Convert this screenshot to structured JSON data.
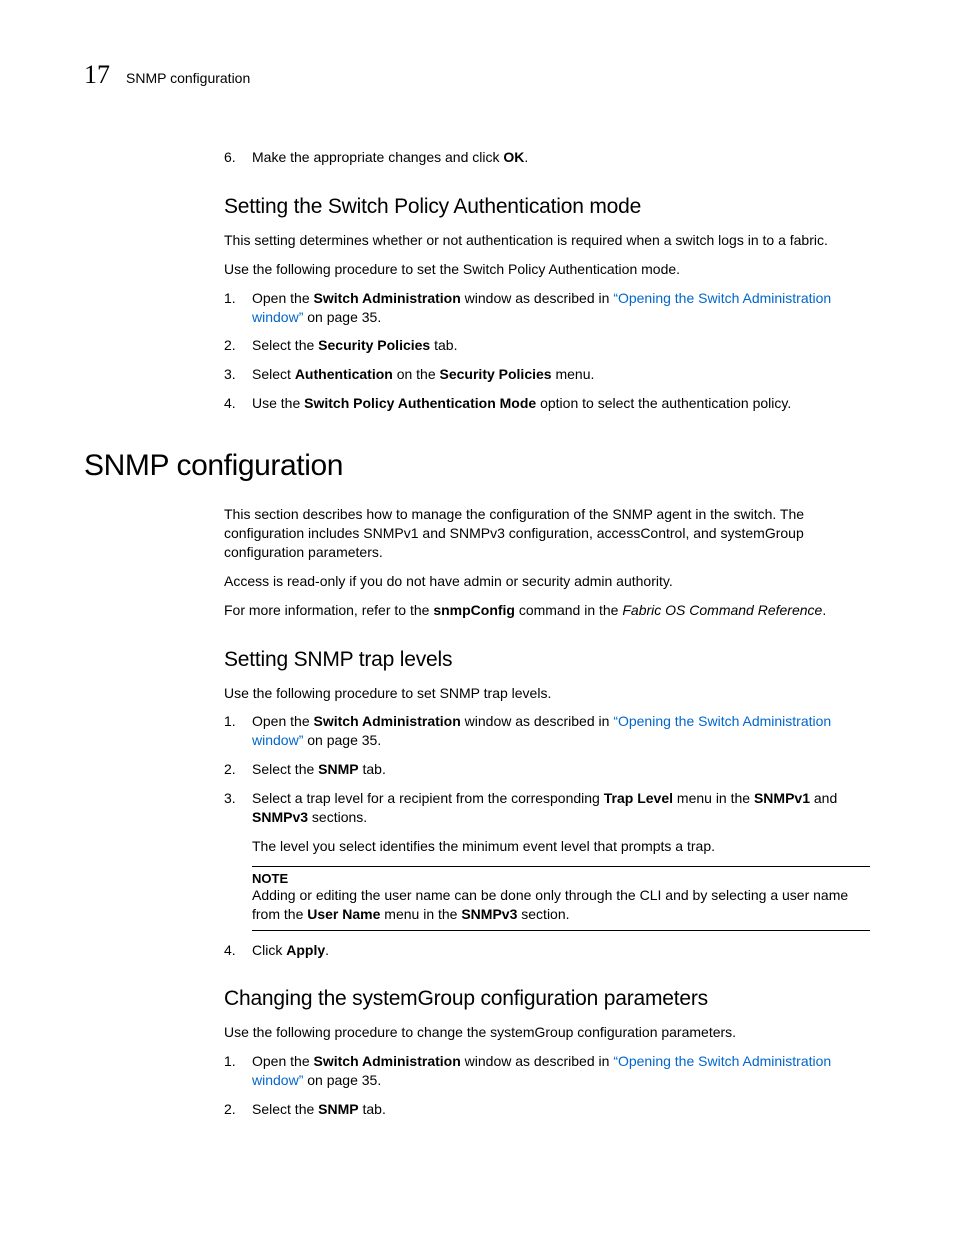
{
  "header": {
    "chapter_number": "17",
    "chapter_label": "SNMP configuration"
  },
  "step6": {
    "text1": "Make the appropriate changes and click ",
    "ok": "OK",
    "text2": "."
  },
  "sec1": {
    "title": "Setting the Switch Policy Authentication mode",
    "p1": "This setting determines whether or not authentication is required when a switch logs in to a fabric.",
    "p2": "Use the following procedure to set the Switch Policy Authentication mode.",
    "li1": {
      "a": "Open the ",
      "b": "Switch Administration",
      "c": " window as described in ",
      "link": "“Opening the Switch Administration window”",
      "d": " on page 35."
    },
    "li2": {
      "a": "Select the ",
      "b": "Security Policies",
      "c": " tab."
    },
    "li3": {
      "a": "Select ",
      "b": "Authentication",
      "c": " on the ",
      "d": "Security Policies",
      "e": " menu."
    },
    "li4": {
      "a": "Use the ",
      "b": "Switch Policy Authentication Mode",
      "c": " option to select the authentication policy."
    }
  },
  "main": {
    "title": "SNMP configuration",
    "p1": "This section describes how to manage the configuration of the SNMP agent in the switch. The configuration includes SNMPv1 and SNMPv3 configuration, accessControl, and systemGroup configuration parameters.",
    "p2": "Access is read-only if you do not have admin or security admin authority.",
    "p3": {
      "a": "For more information, refer to the ",
      "b": "snmpConfig",
      "c": " command in the ",
      "d": "Fabric OS Command Reference",
      "e": "."
    }
  },
  "sec2": {
    "title": "Setting SNMP trap levels",
    "p1": "Use the following procedure to set SNMP trap levels.",
    "li1": {
      "a": "Open the ",
      "b": "Switch Administration",
      "c": " window as described in ",
      "link": "“Opening the Switch Administration window”",
      "d": " on page 35."
    },
    "li2": {
      "a": "Select the ",
      "b": "SNMP",
      "c": " tab."
    },
    "li3": {
      "a": "Select a trap level for a recipient from the corresponding ",
      "b": "Trap Level",
      "c": " menu in the ",
      "d": "SNMPv1",
      "e": " and ",
      "f": "SNMPv3",
      "g": " sections."
    },
    "sub": "The level you select identifies the minimum event level that prompts a trap.",
    "note": {
      "title": "NOTE",
      "a": "Adding or editing the user name can be done only through the CLI and by selecting a user name from the ",
      "b": "User Name",
      "c": " menu in the ",
      "d": "SNMPv3",
      "e": " section."
    },
    "li4": {
      "a": "Click ",
      "b": "Apply",
      "c": "."
    }
  },
  "sec3": {
    "title": "Changing the systemGroup configuration parameters",
    "p1": "Use the following procedure to change the systemGroup configuration parameters.",
    "li1": {
      "a": "Open the ",
      "b": "Switch Administration",
      "c": " window as described in ",
      "link": "“Opening the Switch Administration window”",
      "d": " on page 35."
    },
    "li2": {
      "a": "Select the ",
      "b": "SNMP",
      "c": " tab."
    }
  }
}
